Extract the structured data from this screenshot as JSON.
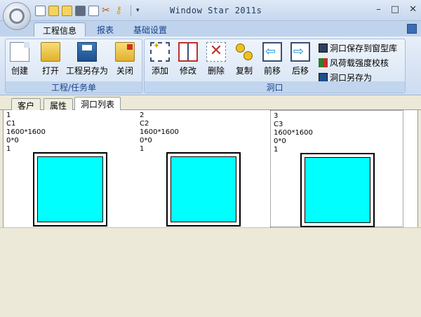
{
  "app": {
    "title": "Window Star 2011s"
  },
  "window_controls": {
    "minimize": "–",
    "maximize": "□",
    "close": "✕"
  },
  "quick_access": {
    "dropdown": "▾"
  },
  "ribbon_tabs": [
    "工程信息",
    "报表",
    "基础设置"
  ],
  "groups": {
    "project": {
      "label": "工程/任务单",
      "buttons": [
        "创建",
        "打开",
        "工程另存为",
        "关闭"
      ]
    },
    "opening": {
      "label": "洞口",
      "buttons": [
        "添加",
        "修改",
        "删除",
        "复制",
        "前移",
        "后移"
      ],
      "small_buttons": [
        "洞口保存到窗型库",
        "风荷载强度校核",
        "洞口另存为"
      ]
    }
  },
  "doc_tabs": [
    "客户",
    "属性",
    "洞口列表"
  ],
  "openings": [
    {
      "index": "1",
      "code": "C1",
      "size": "1600*1600",
      "offset": "0*0",
      "qty": "1"
    },
    {
      "index": "2",
      "code": "C2",
      "size": "1600*1600",
      "offset": "0*0",
      "qty": "1"
    },
    {
      "index": "3",
      "code": "C3",
      "size": "1600*1600",
      "offset": "0*0",
      "qty": "1"
    }
  ],
  "colors": {
    "glass": "#00ffff",
    "ribbon_text": "#15428b"
  }
}
